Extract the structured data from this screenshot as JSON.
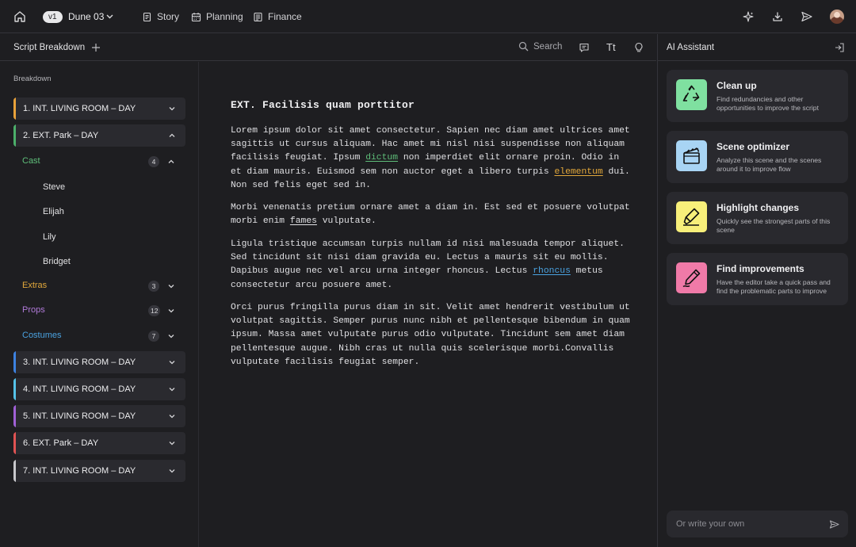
{
  "app": {
    "version": "v1",
    "project": "Dune 03",
    "nav": [
      {
        "label": "Story",
        "icon": "document-icon"
      },
      {
        "label": "Planning",
        "icon": "calendar-icon"
      },
      {
        "label": "Finance",
        "icon": "finance-document-icon"
      }
    ],
    "top_right_icons": [
      "sparkle-icon",
      "download-icon",
      "send-icon",
      "avatar"
    ]
  },
  "toolbar": {
    "panel_title": "Script Breakdown",
    "search_placeholder": "Search",
    "text_size_label": "Tt",
    "icons": [
      "search-icon",
      "comment-icon",
      "text-size-icon",
      "lightbulb-icon"
    ]
  },
  "sidebar": {
    "heading": "Breakdown",
    "scenes_top": [
      {
        "label": "1. INT. LIVING ROOM – DAY",
        "color": "#e8a13a",
        "expanded": false
      },
      {
        "label": "2. EXT. Park – DAY",
        "color": "#4caf6a",
        "expanded": true
      }
    ],
    "categories": [
      {
        "label": "Cast",
        "count": "4",
        "color": "#5fbf7a",
        "expanded": true
      },
      {
        "label": "Extras",
        "count": "3",
        "color": "#e2a83b",
        "expanded": false
      },
      {
        "label": "Props",
        "count": "12",
        "color": "#b07ad8",
        "expanded": false
      },
      {
        "label": "Costumes",
        "count": "7",
        "color": "#4aa2e0",
        "expanded": false
      }
    ],
    "cast": [
      "Steve",
      "Elijah",
      "Lily",
      "Bridget"
    ],
    "scenes_bottom": [
      {
        "label": "3. INT. LIVING ROOM – DAY",
        "color": "#3d82e0"
      },
      {
        "label": "4. INT. LIVING ROOM – DAY",
        "color": "#55c2e8"
      },
      {
        "label": "5. INT. LIVING ROOM – DAY",
        "color": "#a060d6"
      },
      {
        "label": "6. EXT. Park – DAY",
        "color": "#e05353"
      },
      {
        "label": "7. INT. LIVING ROOM – DAY",
        "color": "#c8c8cc"
      }
    ]
  },
  "editor": {
    "scene_heading": "EXT. Facilisis quam porttitor",
    "p1": {
      "a": "Lorem ipsum dolor sit amet consectetur. Sapien nec diam amet ultrices amet sagittis ut cursus aliquam. Hac amet mi nisl nisi suspendisse non aliquam facilisis feugiat. Ipsum ",
      "h1": "dictum",
      "b": " non imperdiet elit ornare proin. Odio in et diam mauris. Euismod sem non auctor eget a libero turpis ",
      "h2": "elementum",
      "c": " dui. Non sed felis eget sed in."
    },
    "p2": {
      "a": "Morbi venenatis pretium ornare amet a diam in. Est sed et posuere volutpat morbi enim ",
      "h1": "fames",
      "b": " vulputate."
    },
    "p3": {
      "a": "Ligula tristique accumsan turpis nullam id nisi malesuada tempor aliquet. Sed tincidunt sit nisi diam gravida eu. Lectus a mauris sit eu mollis. Dapibus augue nec vel arcu urna integer rhoncus. Lectus ",
      "h1": "rhoncus",
      "b": " metus consectetur arcu posuere amet."
    },
    "p4": "Orci purus fringilla purus diam in sit. Velit amet hendrerit vestibulum ut volutpat sagittis. Semper purus nunc nibh et pellentesque bibendum in quam ipsum. Massa amet vulputate purus odio vulputate. Tincidunt sem amet diam pellentesque augue. Nibh cras ut nulla quis scelerisque morbi.Convallis vulputate facilisis feugiat semper.",
    "highlight_colors": {
      "cast": "#5fbf7a",
      "extras": "#e2a83b",
      "plain": "#e0e0e3",
      "costumes": "#4aa2e0"
    }
  },
  "ai": {
    "title": "AI Assistant",
    "cards": [
      {
        "title": "Clean up",
        "desc": "Find redundancies and other opportunities to improve the script",
        "color": "#7fe0a0",
        "icon": "recycle-icon"
      },
      {
        "title": "Scene optimizer",
        "desc": "Analyze this scene and the scenes around it to improve flow",
        "color": "#a8d4f4",
        "icon": "clapperboard-icon"
      },
      {
        "title": "Highlight changes",
        "desc": "Quickly see the strongest parts of this scene",
        "color": "#f7ef7a",
        "icon": "highlighter-icon"
      },
      {
        "title": "Find improvements",
        "desc": "Have the editor take a quick pass and find the problematic parts to improve",
        "color": "#f07aa8",
        "icon": "pen-icon"
      }
    ],
    "prompt_placeholder": "Or write your own"
  }
}
